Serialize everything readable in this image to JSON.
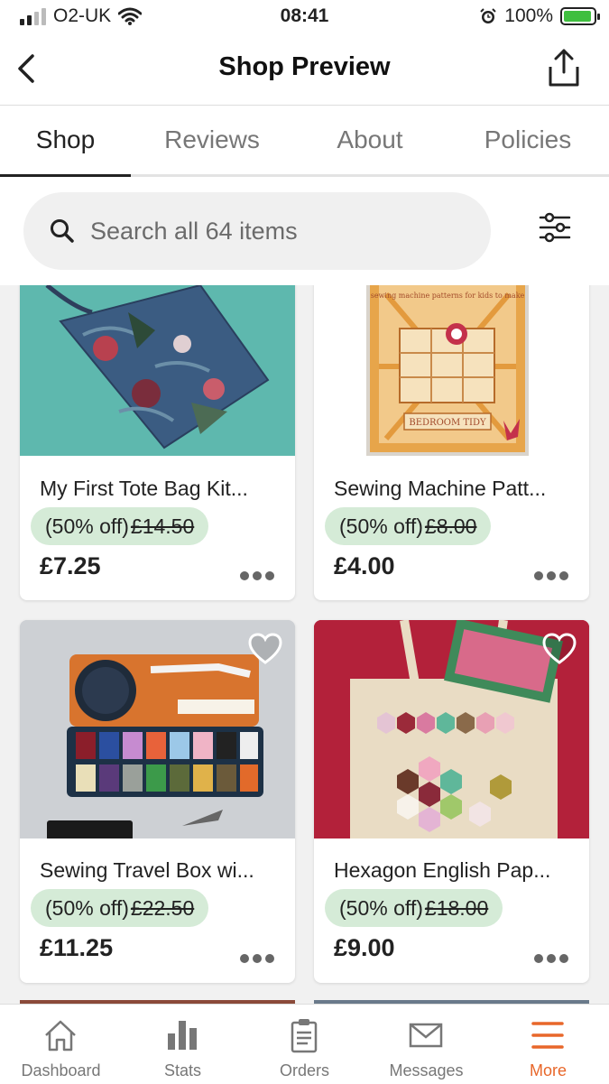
{
  "status_bar": {
    "carrier": "O2-UK",
    "time": "08:41",
    "battery": "100%"
  },
  "header": {
    "title": "Shop Preview"
  },
  "tabs": [
    {
      "label": "Shop"
    },
    {
      "label": "Reviews"
    },
    {
      "label": "About"
    },
    {
      "label": "Policies"
    }
  ],
  "search": {
    "placeholder": "Search all 64 items"
  },
  "listings": [
    {
      "title": "My First Tote Bag Kit...",
      "discount": "(50% off)",
      "original_price": "£14.50",
      "price": "£7.25"
    },
    {
      "title": "Sewing Machine Patt...",
      "discount": "(50% off)",
      "original_price": "£8.00",
      "price": "£4.00"
    },
    {
      "title": "Sewing Travel Box wi...",
      "discount": "(50% off)",
      "original_price": "£22.50",
      "price": "£11.25"
    },
    {
      "title": "Hexagon English Pap...",
      "discount": "(50% off)",
      "original_price": "£18.00",
      "price": "£9.00"
    }
  ],
  "product_image_text": {
    "bedroom_tidy": "BEDROOM TIDY",
    "pattern_top": "sewing machine patterns for kids to make"
  },
  "bottom_nav": [
    {
      "label": "Dashboard",
      "icon": "house-icon"
    },
    {
      "label": "Stats",
      "icon": "bar-chart-icon"
    },
    {
      "label": "Orders",
      "icon": "clipboard-icon"
    },
    {
      "label": "Messages",
      "icon": "envelope-icon"
    },
    {
      "label": "More",
      "icon": "menu-icon"
    }
  ],
  "colors": {
    "accent": "#e8672a",
    "discount_bg": "#d5ebd7",
    "teal_bg": "#5eb8ae",
    "red_bg": "#b3213a"
  }
}
